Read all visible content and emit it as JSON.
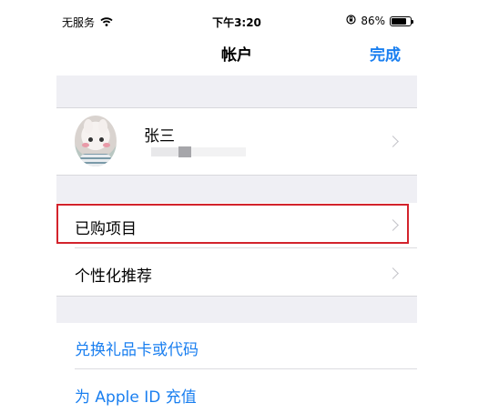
{
  "status_bar": {
    "carrier": "无服务",
    "time": "下午3:20",
    "battery": "86%",
    "battery_level": 0.86
  },
  "nav": {
    "title": "帐户",
    "done_label": "完成"
  },
  "profile": {
    "name": "张三"
  },
  "rows": {
    "purchased": "已购项目",
    "personalized": "个性化推荐",
    "redeem": "兑换礼品卡或代码",
    "add_funds": "为 Apple ID 充值"
  },
  "colors": {
    "accent": "#1a7ff0",
    "highlight": "#d3232c",
    "group_background": "#efeff4"
  }
}
